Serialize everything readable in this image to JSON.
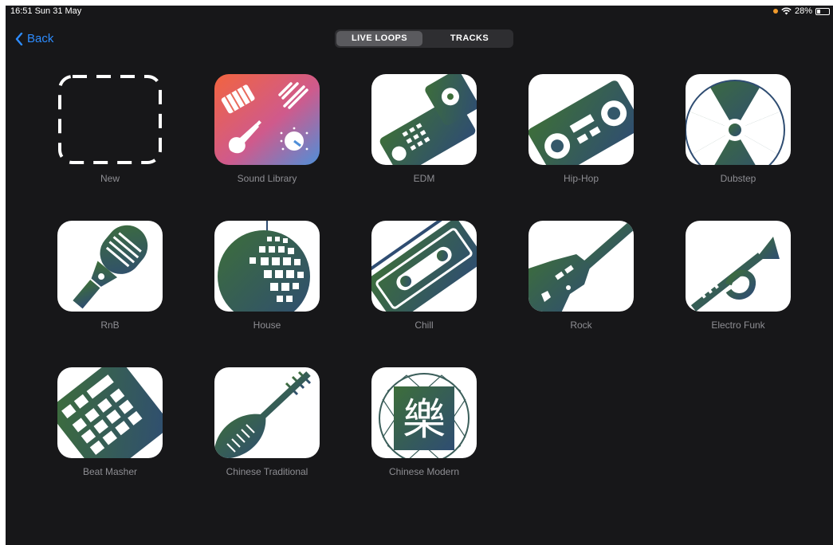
{
  "status_bar": {
    "time": "16:51  Sun 31 May",
    "battery": "28%"
  },
  "nav": {
    "back_label": "Back"
  },
  "segmented_control": {
    "live_loops": "LIVE LOOPS",
    "tracks": "TRACKS"
  },
  "templates": [
    {
      "label": "New",
      "icon": "dashed-plus-placeholder-icon"
    },
    {
      "label": "Sound Library",
      "icon": "sound-library-icon"
    },
    {
      "label": "EDM",
      "icon": "edm-controller-icon"
    },
    {
      "label": "Hip-Hop",
      "icon": "boombox-icon"
    },
    {
      "label": "Dubstep",
      "icon": "speaker-hazard-icon"
    },
    {
      "label": "RnB",
      "icon": "microphone-icon"
    },
    {
      "label": "House",
      "icon": "disco-ball-icon"
    },
    {
      "label": "Chill",
      "icon": "cassette-icon"
    },
    {
      "label": "Rock",
      "icon": "electric-guitar-icon"
    },
    {
      "label": "Electro Funk",
      "icon": "trumpet-icon"
    },
    {
      "label": "Beat Masher",
      "icon": "drum-pad-icon"
    },
    {
      "label": "Chinese Traditional",
      "icon": "pipa-icon"
    },
    {
      "label": "Chinese Modern",
      "icon": "chinese-character-icon",
      "glyph": "樂"
    }
  ],
  "colors": {
    "background": "#171719",
    "accent": "#2d8cff",
    "label": "#8e8e93"
  }
}
